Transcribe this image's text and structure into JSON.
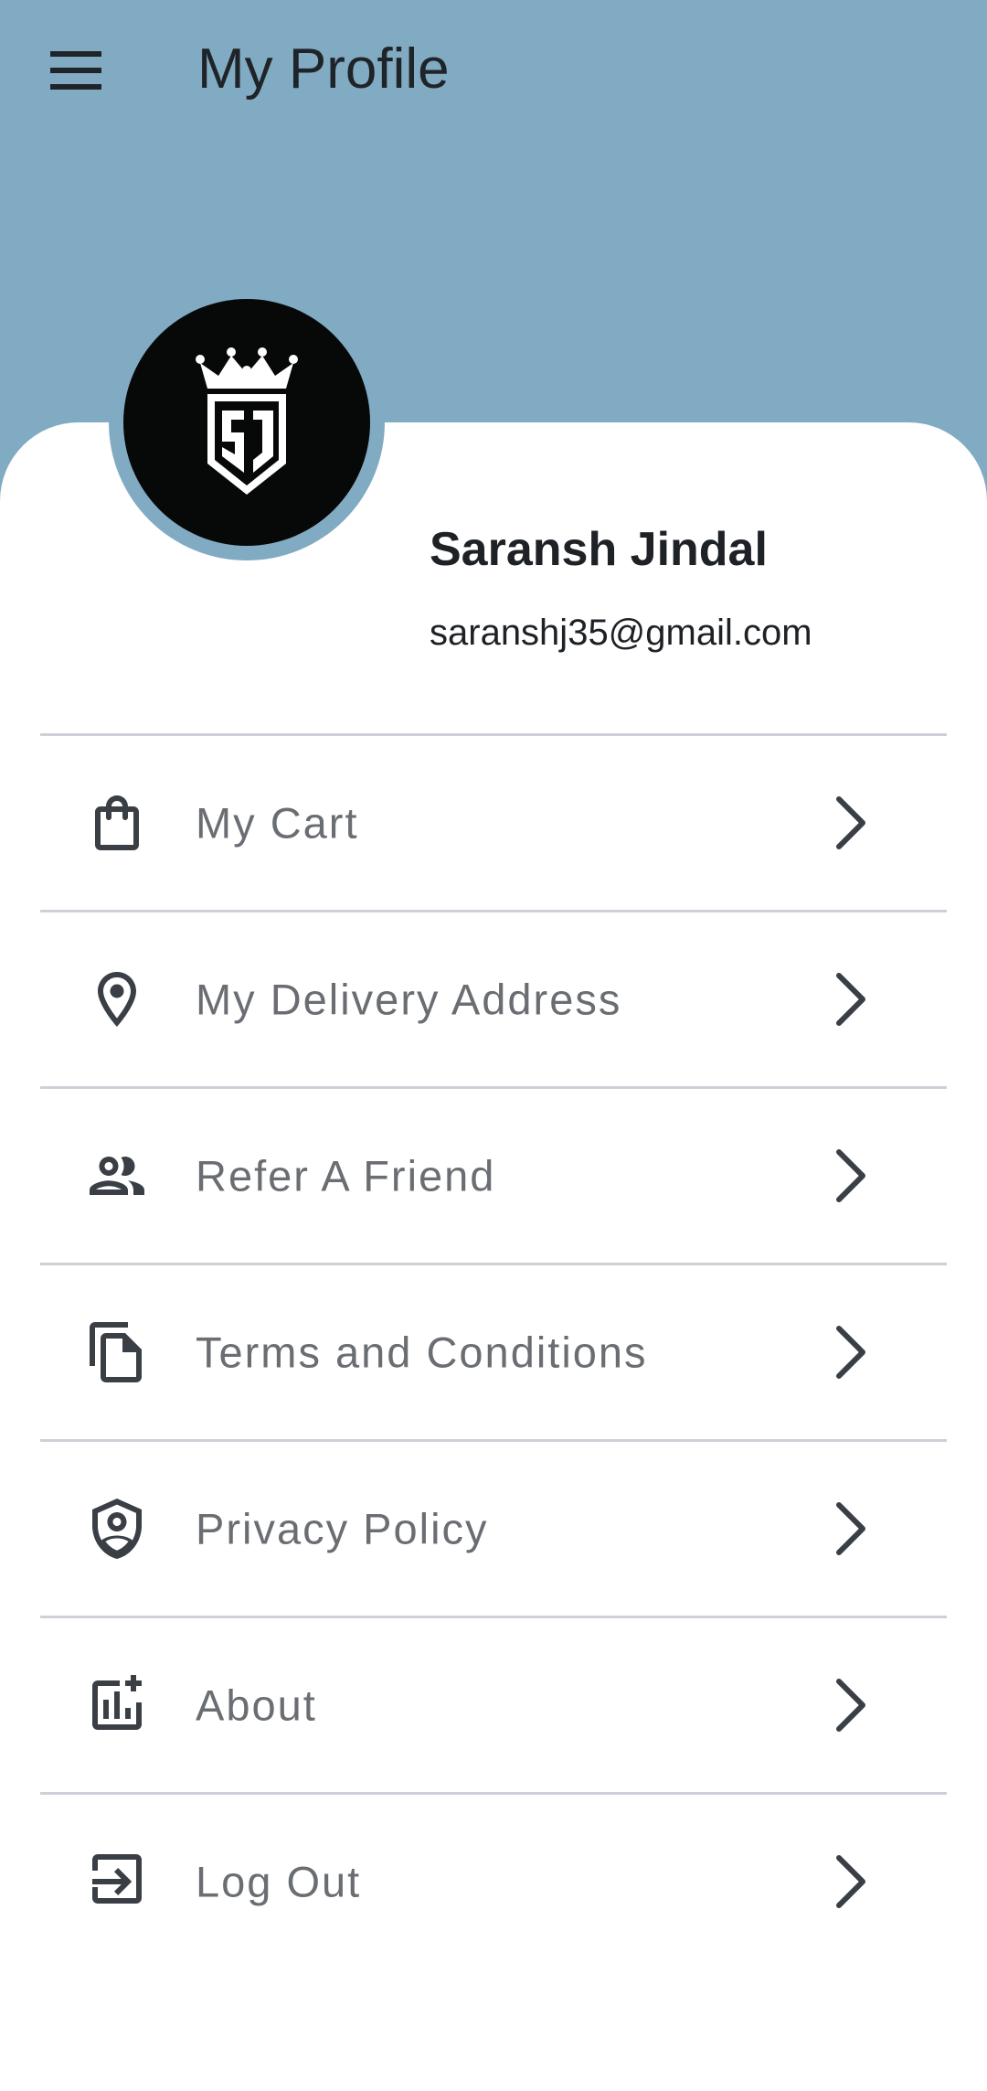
{
  "appbar": {
    "title": "My Profile",
    "menu_icon": "hamburger-menu-icon"
  },
  "profile": {
    "name": "Saransh Jindal",
    "email": "saranshj35@gmail.com",
    "avatar_logo": "SJ"
  },
  "menu": {
    "items": [
      {
        "label": "My Cart",
        "icon": "shopping-bag-icon"
      },
      {
        "label": "My Delivery Address",
        "icon": "location-pin-icon"
      },
      {
        "label": "Refer A Friend",
        "icon": "people-icon"
      },
      {
        "label": "Terms and Conditions",
        "icon": "documents-icon"
      },
      {
        "label": "Privacy Policy",
        "icon": "shield-user-icon"
      },
      {
        "label": "About",
        "icon": "chart-add-icon"
      },
      {
        "label": "Log Out",
        "icon": "logout-icon"
      }
    ]
  },
  "colors": {
    "header": "#81abc3",
    "text": "#1e2226",
    "menu_text": "#6a6e73",
    "divider": "#cdd1d7"
  }
}
